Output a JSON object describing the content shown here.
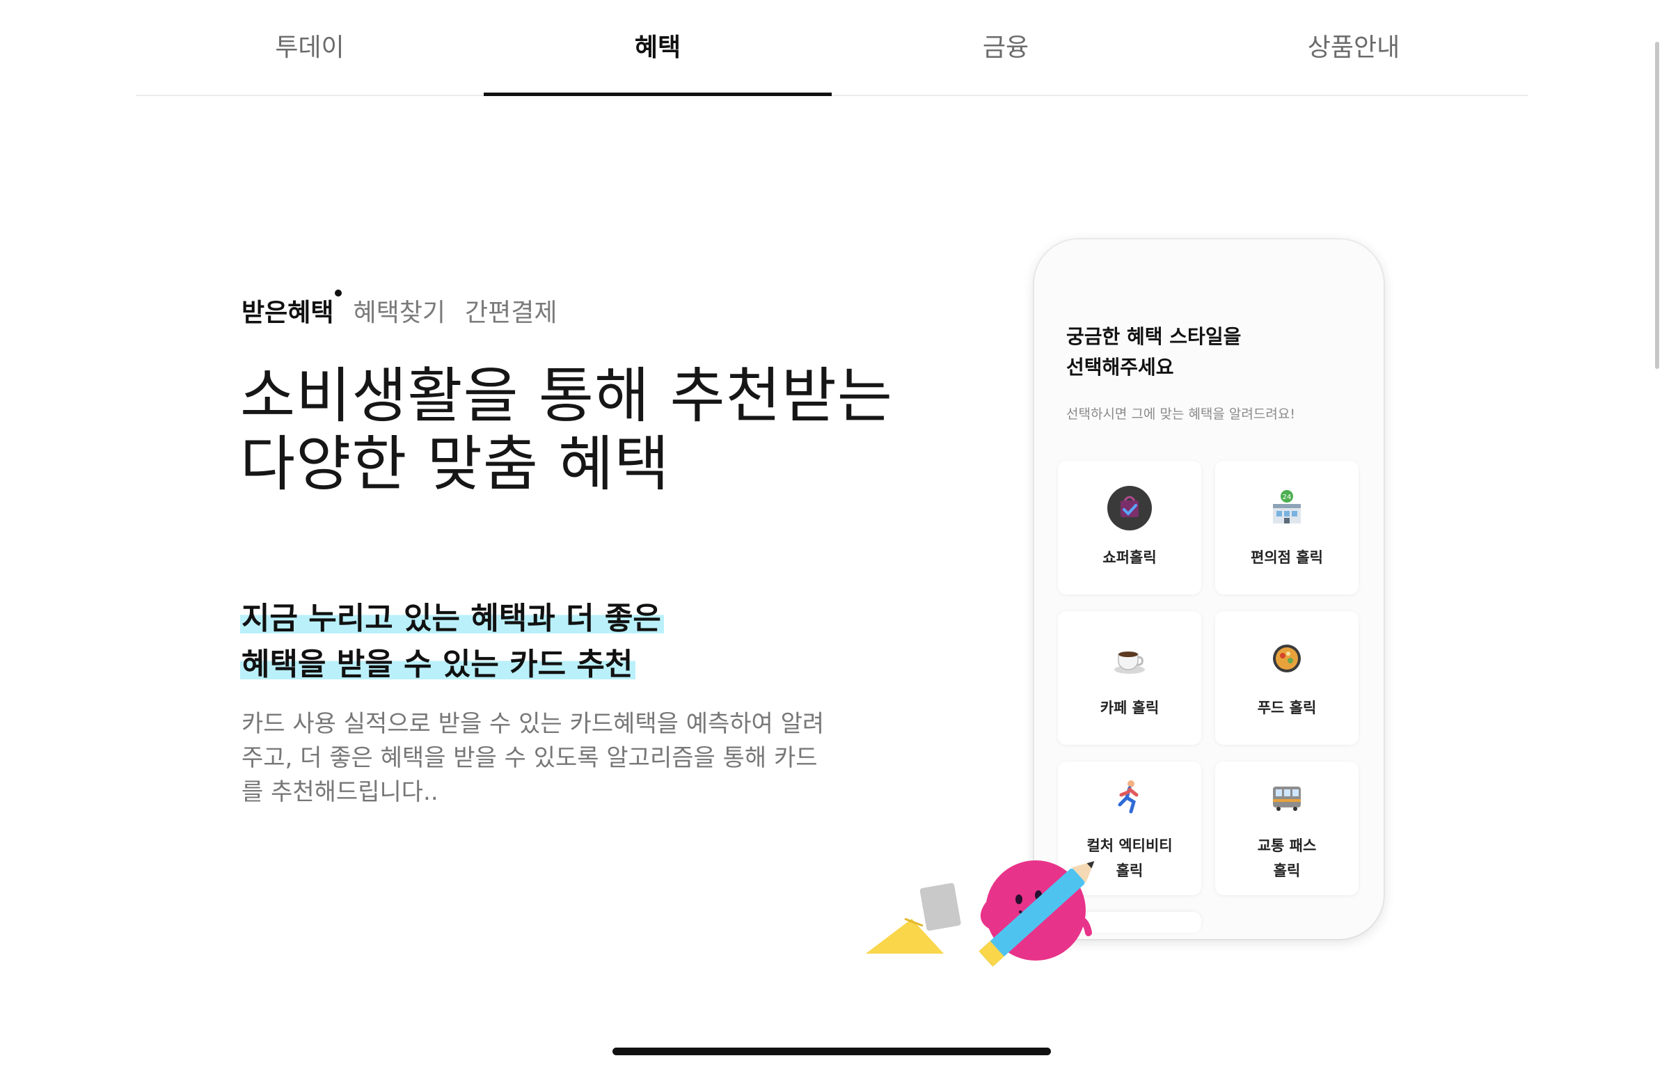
{
  "top_tabs": [
    {
      "label": "투데이",
      "active": false
    },
    {
      "label": "혜택",
      "active": true
    },
    {
      "label": "금융",
      "active": false
    },
    {
      "label": "상품안내",
      "active": false
    }
  ],
  "sub_tabs": [
    {
      "label": "받은혜택",
      "active": true
    },
    {
      "label": "혜택찾기",
      "active": false
    },
    {
      "label": "간편결제",
      "active": false
    }
  ],
  "headline": {
    "line1": "소비생활을 통해 추천받는",
    "line2": "다양한 맞춤 혜택"
  },
  "highlight": {
    "line1": "지금 누리고 있는 혜택과 더 좋은",
    "line2": "혜택을 받을 수 있는 카드 추천"
  },
  "description": "카드 사용 실적으로 받을 수 있는 카드혜택을 예측하여 알려주고, 더 좋은 혜택을 받을 수 있도록 알고리즘을 통해 카드를 추천해드립니다..",
  "phone": {
    "title_line1": "궁금한 혜택 스타일을",
    "title_line2": "선택해주세요",
    "subtitle": "선택하시면 그에 맞는 혜택을 알려드려요!",
    "styles": [
      {
        "label": "쇼퍼홀릭",
        "icon": "shopping-bag-icon"
      },
      {
        "label": "편의점 홀릭",
        "icon": "convenience-store-icon"
      },
      {
        "label": "카페 홀릭",
        "icon": "coffee-cup-icon"
      },
      {
        "label": "푸드 홀릭",
        "icon": "food-pan-icon"
      },
      {
        "label": "컬처 엑티비티\n홀릭",
        "icon": "runner-icon"
      },
      {
        "label": "교통 패스\n홀릭",
        "icon": "tram-icon"
      }
    ]
  },
  "colors": {
    "highlight": "#baf0fa",
    "active_text": "#111111",
    "inactive_text": "#6b6b6b",
    "character_pink": "#e8338a",
    "pencil_blue": "#4fc3f0",
    "paper_yellow": "#f9d64a"
  }
}
